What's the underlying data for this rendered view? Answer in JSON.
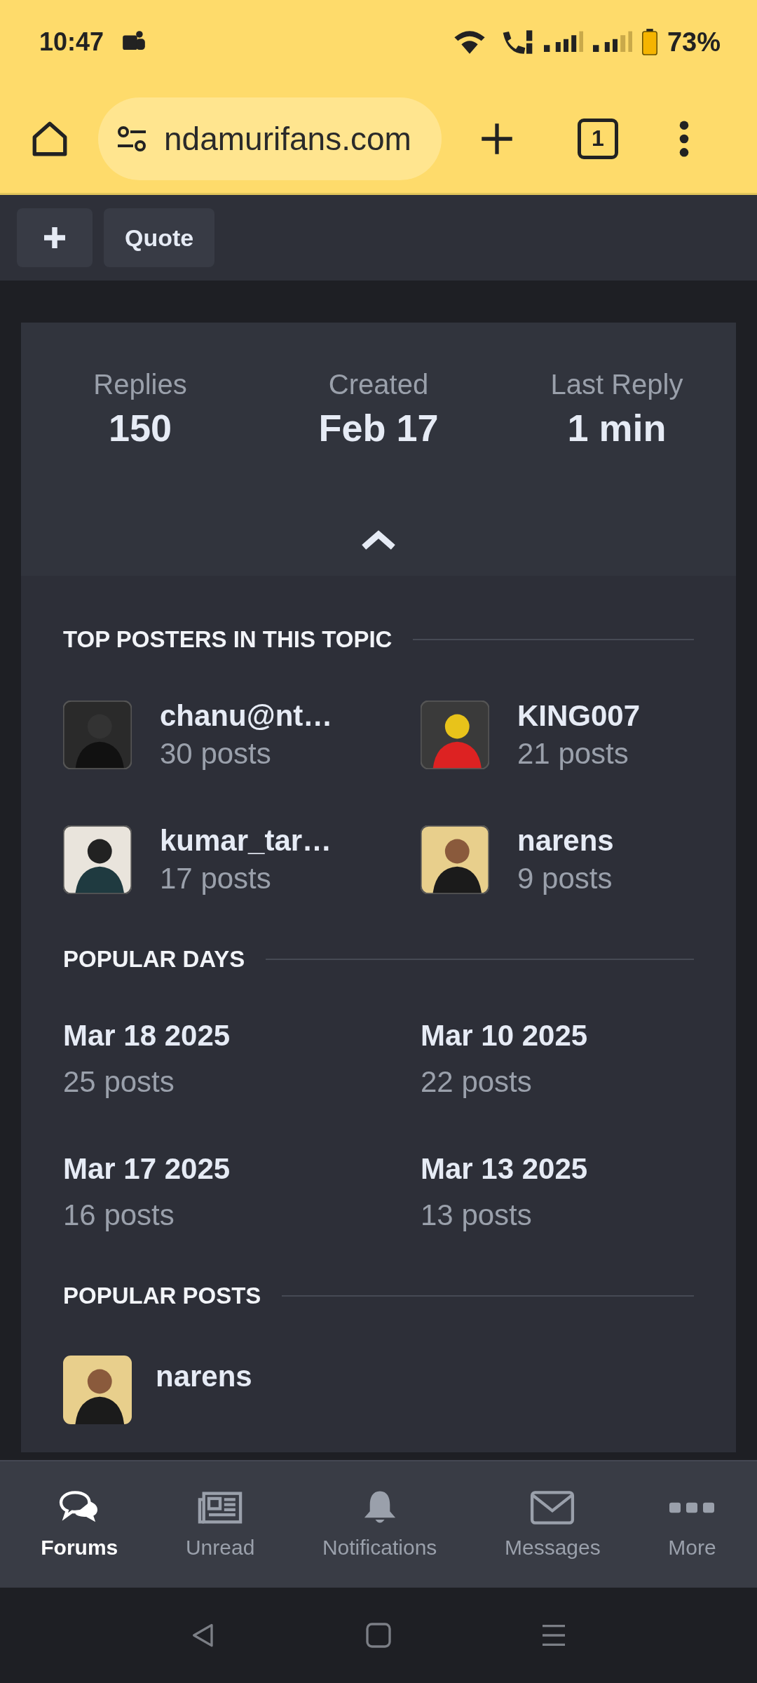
{
  "status_bar": {
    "time": "10:47",
    "battery": "73%"
  },
  "browser": {
    "url": "ndamurifans.com",
    "tab_count": "1"
  },
  "actions": {
    "quote": "Quote"
  },
  "stats": [
    {
      "label": "Replies",
      "value": "150"
    },
    {
      "label": "Created",
      "value": "Feb 17"
    },
    {
      "label": "Last Reply",
      "value": "1 min"
    }
  ],
  "top_posters": {
    "heading": "TOP POSTERS IN THIS TOPIC",
    "items": [
      {
        "name": "chanu@nt…",
        "posts": "30 posts"
      },
      {
        "name": "KING007",
        "posts": "21 posts"
      },
      {
        "name": "kumar_tar…",
        "posts": "17 posts"
      },
      {
        "name": "narens",
        "posts": "9 posts"
      }
    ]
  },
  "popular_days": {
    "heading": "POPULAR DAYS",
    "items": [
      {
        "date": "Mar 18 2025",
        "posts": "25 posts"
      },
      {
        "date": "Mar 10 2025",
        "posts": "22 posts"
      },
      {
        "date": "Mar 17 2025",
        "posts": "16 posts"
      },
      {
        "date": "Mar 13 2025",
        "posts": "13 posts"
      }
    ]
  },
  "popular_posts": {
    "heading": "POPULAR POSTS",
    "items": [
      {
        "name": "narens"
      }
    ]
  },
  "bottom_nav": [
    {
      "label": "Forums",
      "kind": "forums",
      "selected": true
    },
    {
      "label": "Unread",
      "kind": "unread",
      "selected": false
    },
    {
      "label": "Notifications",
      "kind": "bell",
      "selected": false
    },
    {
      "label": "Messages",
      "kind": "mail",
      "selected": false
    },
    {
      "label": "More",
      "kind": "more",
      "selected": false
    }
  ]
}
